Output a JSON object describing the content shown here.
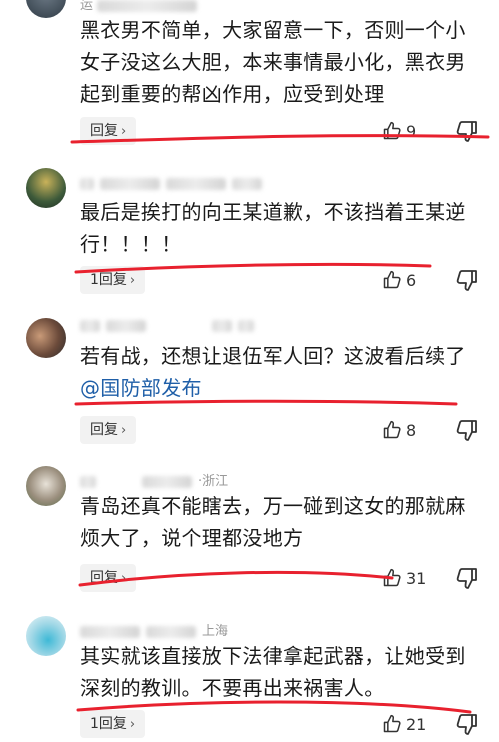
{
  "comments": [
    {
      "meta_text": "运",
      "meta_suffix": "",
      "content": "黑衣男不简单，大家留意一下，否则一个小女子没这么大胆，本来事情最小化，黑衣男起到重要的帮凶作用，应受到处理",
      "mention": "",
      "reply_label": "回复",
      "likes": "9"
    },
    {
      "meta_text": "",
      "meta_suffix": "",
      "content": "最后是挨打的向王某道歉，不该挡着王某逆行！！！！",
      "mention": "",
      "reply_label": "1回复",
      "likes": "6"
    },
    {
      "meta_text": "",
      "meta_suffix": "",
      "content": "若有战，还想让退伍军人回？这波看后续了",
      "mention": "@国防部发布",
      "reply_label": "回复",
      "likes": "8"
    },
    {
      "meta_text": "",
      "meta_suffix": "·浙江",
      "content": "青岛还真不能瞎去，万一碰到这女的那就麻烦大了，说个理都没地方",
      "mention": "",
      "reply_label": "回复",
      "likes": "31"
    },
    {
      "meta_text": "",
      "meta_suffix": "上海",
      "content": "其实就该直接放下法律拿起武器，让她受到深刻的教训。不要再出来祸害人。",
      "mention": "",
      "reply_label": "1回复",
      "likes": "21"
    }
  ],
  "icons": {
    "like": "thumbs-up-icon",
    "dislike": "thumbs-down-icon",
    "chevron": "chevron-right-icon"
  },
  "colors": {
    "underline": "#e8212e",
    "mention": "#1f5fa8",
    "reply_bg": "#f2f2f2"
  }
}
